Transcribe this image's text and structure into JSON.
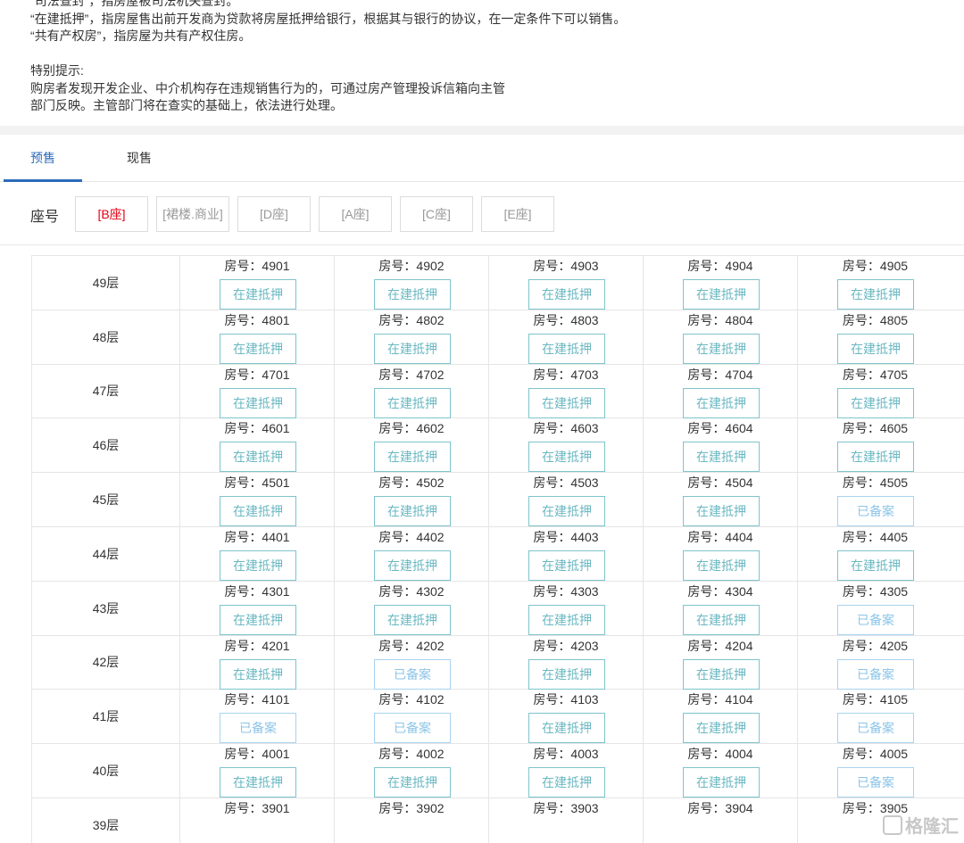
{
  "notes": {
    "line1": "“司法查封”，指房屋被司法机关查封。",
    "line2": "“在建抵押”，指房屋售出前开发商为贷款将房屋抵押给银行，根据其与银行的协议，在一定条件下可以销售。",
    "line3": "“共有产权房”，指房屋为共有产权住房。",
    "tip_title": "特别提示:",
    "tip_line1": "购房者发现开发企业、中介机构存在违规销售行为的，可通过房产管理投诉信箱向主管",
    "tip_line2": "部门反映。主管部门将在查实的基础上，依法进行处理。"
  },
  "tabs": [
    {
      "label": "预售",
      "active": true
    },
    {
      "label": "现售",
      "active": false
    }
  ],
  "seat": {
    "label": "座号",
    "options": [
      {
        "label": "[B座]",
        "active": true
      },
      {
        "label": "[裙楼.商业]",
        "active": false
      },
      {
        "label": "[D座]",
        "active": false
      },
      {
        "label": "[A座]",
        "active": false
      },
      {
        "label": "[C座]",
        "active": false
      },
      {
        "label": "[E座]",
        "active": false
      }
    ]
  },
  "unit_prefix": "房号：",
  "floors": [
    {
      "label": "49层",
      "units": [
        {
          "no": "4901",
          "status": "在建抵押"
        },
        {
          "no": "4902",
          "status": "在建抵押"
        },
        {
          "no": "4903",
          "status": "在建抵押"
        },
        {
          "no": "4904",
          "status": "在建抵押"
        },
        {
          "no": "4905",
          "status": "在建抵押"
        }
      ]
    },
    {
      "label": "48层",
      "units": [
        {
          "no": "4801",
          "status": "在建抵押"
        },
        {
          "no": "4802",
          "status": "在建抵押"
        },
        {
          "no": "4803",
          "status": "在建抵押"
        },
        {
          "no": "4804",
          "status": "在建抵押"
        },
        {
          "no": "4805",
          "status": "在建抵押"
        }
      ]
    },
    {
      "label": "47层",
      "units": [
        {
          "no": "4701",
          "status": "在建抵押"
        },
        {
          "no": "4702",
          "status": "在建抵押"
        },
        {
          "no": "4703",
          "status": "在建抵押"
        },
        {
          "no": "4704",
          "status": "在建抵押"
        },
        {
          "no": "4705",
          "status": "在建抵押"
        }
      ]
    },
    {
      "label": "46层",
      "units": [
        {
          "no": "4601",
          "status": "在建抵押"
        },
        {
          "no": "4602",
          "status": "在建抵押"
        },
        {
          "no": "4603",
          "status": "在建抵押"
        },
        {
          "no": "4604",
          "status": "在建抵押"
        },
        {
          "no": "4605",
          "status": "在建抵押"
        }
      ]
    },
    {
      "label": "45层",
      "units": [
        {
          "no": "4501",
          "status": "在建抵押"
        },
        {
          "no": "4502",
          "status": "在建抵押"
        },
        {
          "no": "4503",
          "status": "在建抵押"
        },
        {
          "no": "4504",
          "status": "在建抵押"
        },
        {
          "no": "4505",
          "status": "已备案"
        }
      ]
    },
    {
      "label": "44层",
      "units": [
        {
          "no": "4401",
          "status": "在建抵押"
        },
        {
          "no": "4402",
          "status": "在建抵押"
        },
        {
          "no": "4403",
          "status": "在建抵押"
        },
        {
          "no": "4404",
          "status": "在建抵押"
        },
        {
          "no": "4405",
          "status": "在建抵押"
        }
      ]
    },
    {
      "label": "43层",
      "units": [
        {
          "no": "4301",
          "status": "在建抵押"
        },
        {
          "no": "4302",
          "status": "在建抵押"
        },
        {
          "no": "4303",
          "status": "在建抵押"
        },
        {
          "no": "4304",
          "status": "在建抵押"
        },
        {
          "no": "4305",
          "status": "已备案"
        }
      ]
    },
    {
      "label": "42层",
      "units": [
        {
          "no": "4201",
          "status": "在建抵押"
        },
        {
          "no": "4202",
          "status": "已备案"
        },
        {
          "no": "4203",
          "status": "在建抵押"
        },
        {
          "no": "4204",
          "status": "在建抵押"
        },
        {
          "no": "4205",
          "status": "已备案"
        }
      ]
    },
    {
      "label": "41层",
      "units": [
        {
          "no": "4101",
          "status": "已备案"
        },
        {
          "no": "4102",
          "status": "已备案"
        },
        {
          "no": "4103",
          "status": "在建抵押"
        },
        {
          "no": "4104",
          "status": "在建抵押"
        },
        {
          "no": "4105",
          "status": "已备案"
        }
      ]
    },
    {
      "label": "40层",
      "units": [
        {
          "no": "4001",
          "status": "在建抵押"
        },
        {
          "no": "4002",
          "status": "在建抵押"
        },
        {
          "no": "4003",
          "status": "在建抵押"
        },
        {
          "no": "4004",
          "status": "在建抵押"
        },
        {
          "no": "4005",
          "status": "已备案"
        }
      ]
    },
    {
      "label": "39层",
      "units": [
        {
          "no": "3901",
          "status": ""
        },
        {
          "no": "3902",
          "status": ""
        },
        {
          "no": "3903",
          "status": ""
        },
        {
          "no": "3904",
          "status": ""
        },
        {
          "no": "3905",
          "status": ""
        }
      ]
    }
  ],
  "watermark": "格隆汇",
  "colors": {
    "accent": "#2d6bb8",
    "active_seat": "#e60012",
    "status_mortgage": "#6bb8c2",
    "status_filed": "#8bc4e8"
  }
}
